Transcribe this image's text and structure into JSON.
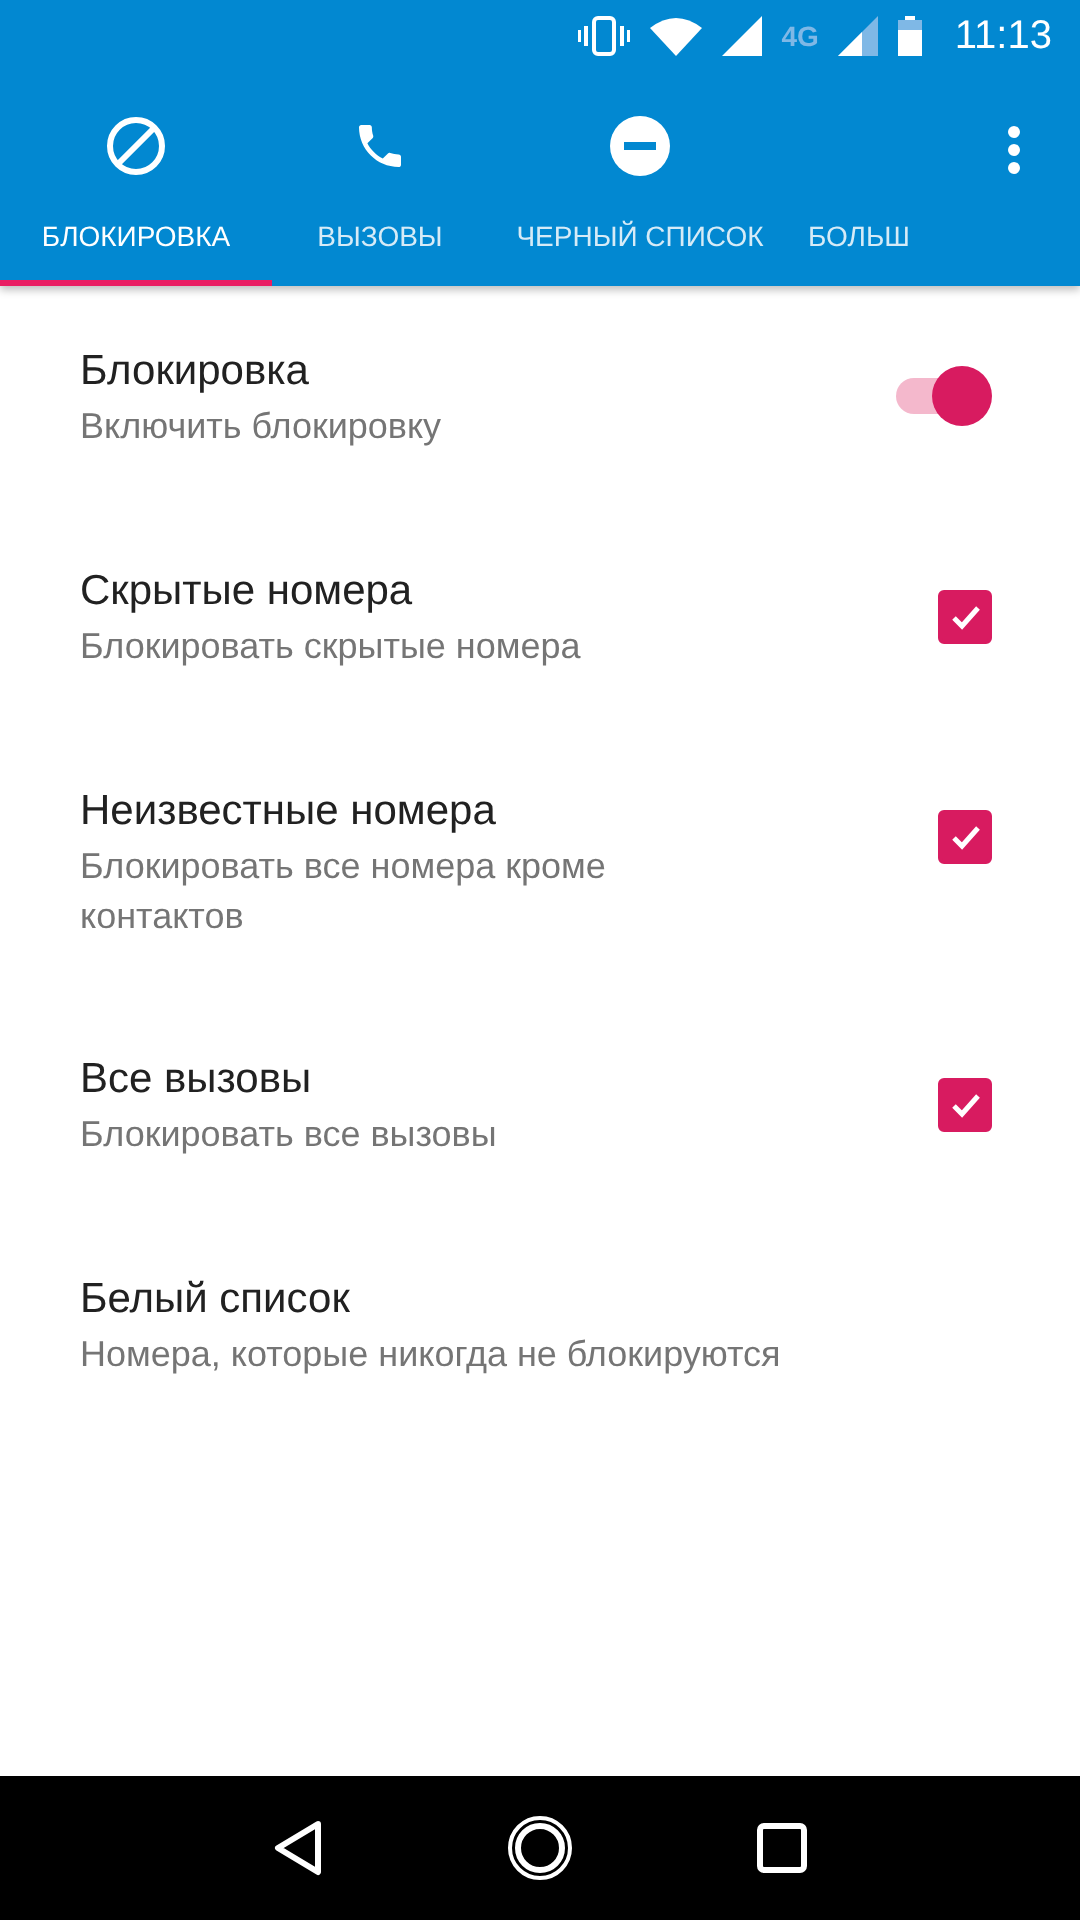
{
  "status_bar": {
    "network": "4G",
    "time": "11:13"
  },
  "tabs": [
    {
      "label": "БЛОКИРОВКА",
      "selected": true
    },
    {
      "label": "ВЫЗОВЫ",
      "selected": false
    },
    {
      "label": "ЧЕРНЫЙ СПИСОК",
      "selected": false
    },
    {
      "label": "БОЛЬШ",
      "selected": false
    }
  ],
  "settings": [
    {
      "kind": "toggle",
      "title": "Блокировка",
      "subtitle": "Включить блокировку",
      "on": true
    },
    {
      "kind": "checkbox",
      "title": "Скрытые номера",
      "subtitle": "Блокировать скрытые номера",
      "checked": true
    },
    {
      "kind": "checkbox",
      "title": "Неизвестные номера",
      "subtitle": "Блокировать все номера кроме контактов",
      "checked": true
    },
    {
      "kind": "checkbox",
      "title": "Все вызовы",
      "subtitle": "Блокировать все вызовы",
      "checked": true
    },
    {
      "kind": "plain",
      "title": "Белый список",
      "subtitle": "Номера, которые никогда не блокируются"
    }
  ]
}
